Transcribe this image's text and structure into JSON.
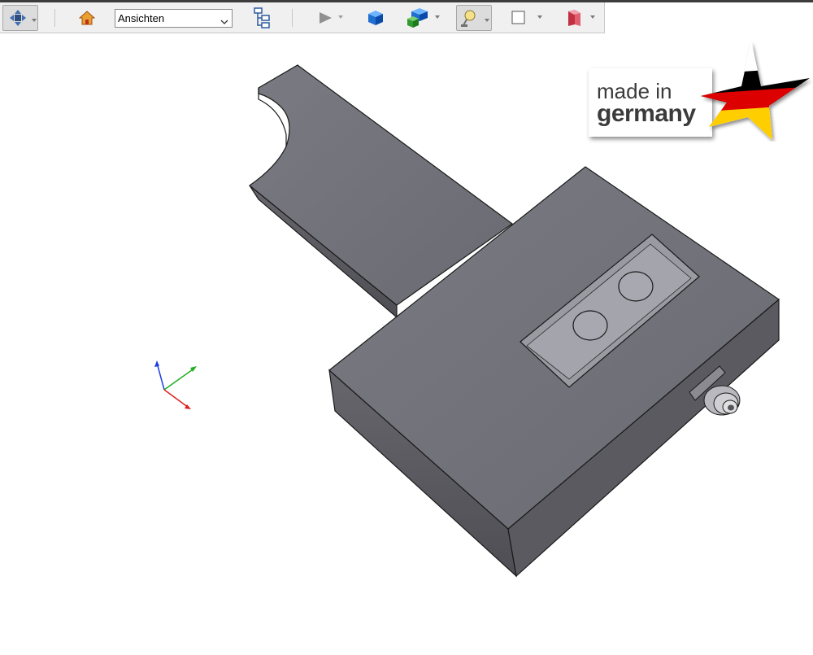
{
  "toolbar": {
    "buttons": [
      {
        "name": "view-navigation-button",
        "icon": "navigation-cross-icon",
        "has_dropdown": true
      },
      {
        "name": "home-view-button",
        "icon": "home-icon",
        "has_dropdown": false
      },
      {
        "name": "assembly-tree-button",
        "icon": "tree-structure-icon",
        "has_dropdown": false
      },
      {
        "name": "animation-play-button",
        "icon": "play-icon",
        "has_dropdown": true
      },
      {
        "name": "shaded-cube-button",
        "icon": "cube-icon",
        "has_dropdown": false
      },
      {
        "name": "render-mode-button",
        "icon": "cubes-icon",
        "has_dropdown": true
      },
      {
        "name": "lighting-button",
        "icon": "lamp-icon",
        "has_dropdown": true
      },
      {
        "name": "background-color-button",
        "icon": "white-square-icon",
        "has_dropdown": true
      },
      {
        "name": "cross-section-button",
        "icon": "section-plane-icon",
        "has_dropdown": true
      }
    ],
    "views_select": {
      "value": "Ansichten"
    }
  },
  "badge": {
    "line1": "made in",
    "line2": "germany",
    "flag_colors": [
      "#000000",
      "#dd0000",
      "#ffce00"
    ]
  },
  "colors": {
    "part_top": "#76767e",
    "part_side": "#5a5a60",
    "part_edge": "#1a1a1a",
    "axis_x": "#e02020",
    "axis_y": "#20b020",
    "axis_z": "#2040e0"
  }
}
